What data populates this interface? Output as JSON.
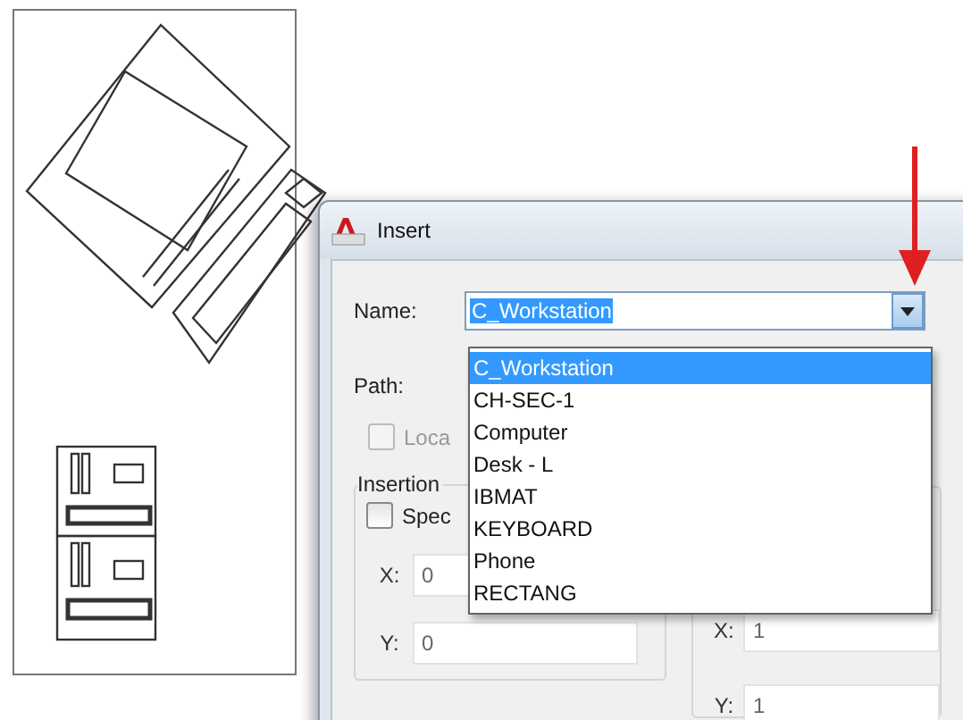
{
  "dialog": {
    "title": "Insert"
  },
  "name_field": {
    "label": "Name:",
    "value": "C_Workstation",
    "expanded": true
  },
  "dropdown": {
    "items": [
      {
        "label": "C_Workstation",
        "selected": true
      },
      {
        "label": "CH-SEC-1",
        "selected": false
      },
      {
        "label": "Computer",
        "selected": false
      },
      {
        "label": "Desk - L",
        "selected": false
      },
      {
        "label": "IBMAT",
        "selected": false
      },
      {
        "label": "KEYBOARD",
        "selected": false
      },
      {
        "label": "Phone",
        "selected": false
      },
      {
        "label": "RECTANG",
        "selected": false
      }
    ]
  },
  "path": {
    "label": "Path:"
  },
  "locate": {
    "label": "Loca",
    "checked": false,
    "disabled": true
  },
  "insertion_point": {
    "title": "Insertion",
    "specify": {
      "label": "Spec",
      "checked": false
    },
    "x": {
      "label": "X:",
      "value": "0"
    },
    "y": {
      "label": "Y:",
      "value": "0"
    }
  },
  "scale": {
    "x": {
      "label": "X:",
      "value": "1"
    },
    "y": {
      "label": "Y:",
      "value": "1"
    }
  }
}
